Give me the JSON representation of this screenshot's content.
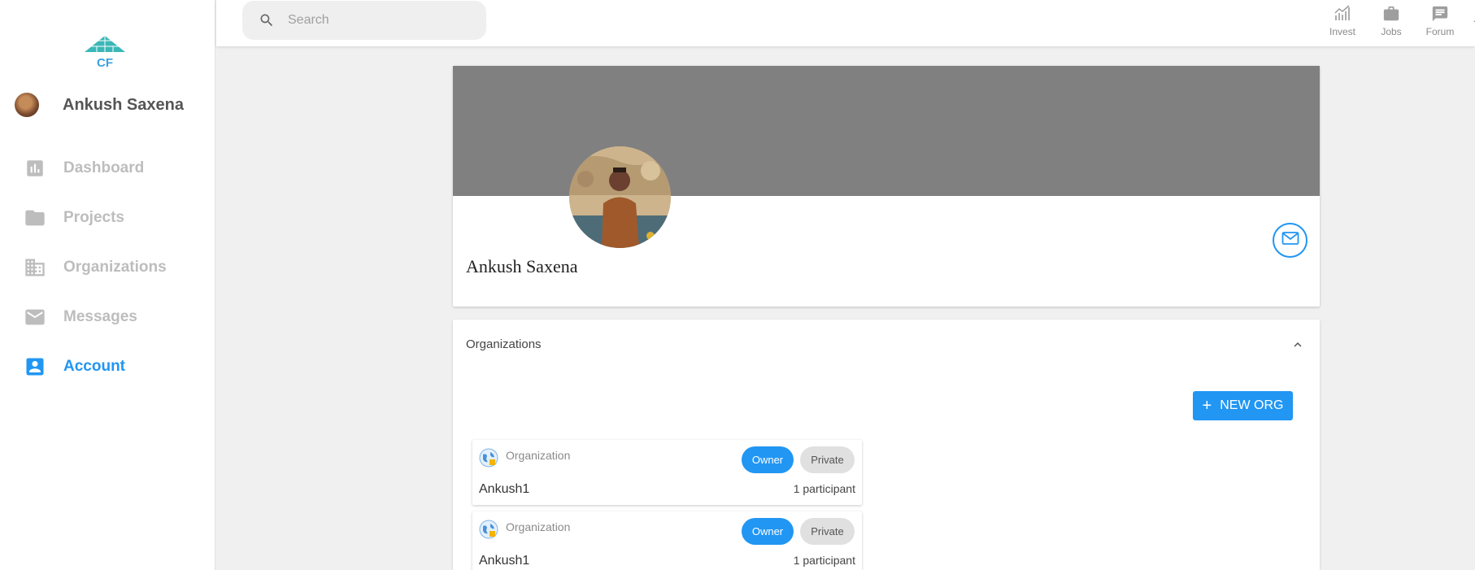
{
  "sidebar": {
    "logo_text": "CF",
    "user_name": "Ankush Saxena",
    "nav": [
      {
        "label": "Dashboard",
        "icon": "bar-chart-icon",
        "active": false
      },
      {
        "label": "Projects",
        "icon": "folder-icon",
        "active": false
      },
      {
        "label": "Organizations",
        "icon": "building-icon",
        "active": false
      },
      {
        "label": "Messages",
        "icon": "envelope-icon",
        "active": false
      },
      {
        "label": "Account",
        "icon": "account-box-icon",
        "active": true
      }
    ]
  },
  "topbar": {
    "search_placeholder": "Search",
    "links": [
      {
        "label": "Invest",
        "icon": "trending-up-icon"
      },
      {
        "label": "Jobs",
        "icon": "briefcase-icon"
      },
      {
        "label": "Forum",
        "icon": "chat-icon"
      }
    ]
  },
  "profile": {
    "name": "Ankush Saxena"
  },
  "organizations": {
    "header": "Organizations",
    "new_button": "NEW ORG",
    "items": [
      {
        "type": "Organization",
        "name": "Ankush1",
        "role": "Owner",
        "visibility": "Private",
        "participants": "1 participant"
      },
      {
        "type": "Organization",
        "name": "Ankush1",
        "role": "Owner",
        "visibility": "Private",
        "participants": "1 participant"
      }
    ]
  },
  "colors": {
    "accent": "#2196f3",
    "inactive_nav": "#bdbdbd",
    "cover": "#808080",
    "background": "#f0f0f0"
  }
}
